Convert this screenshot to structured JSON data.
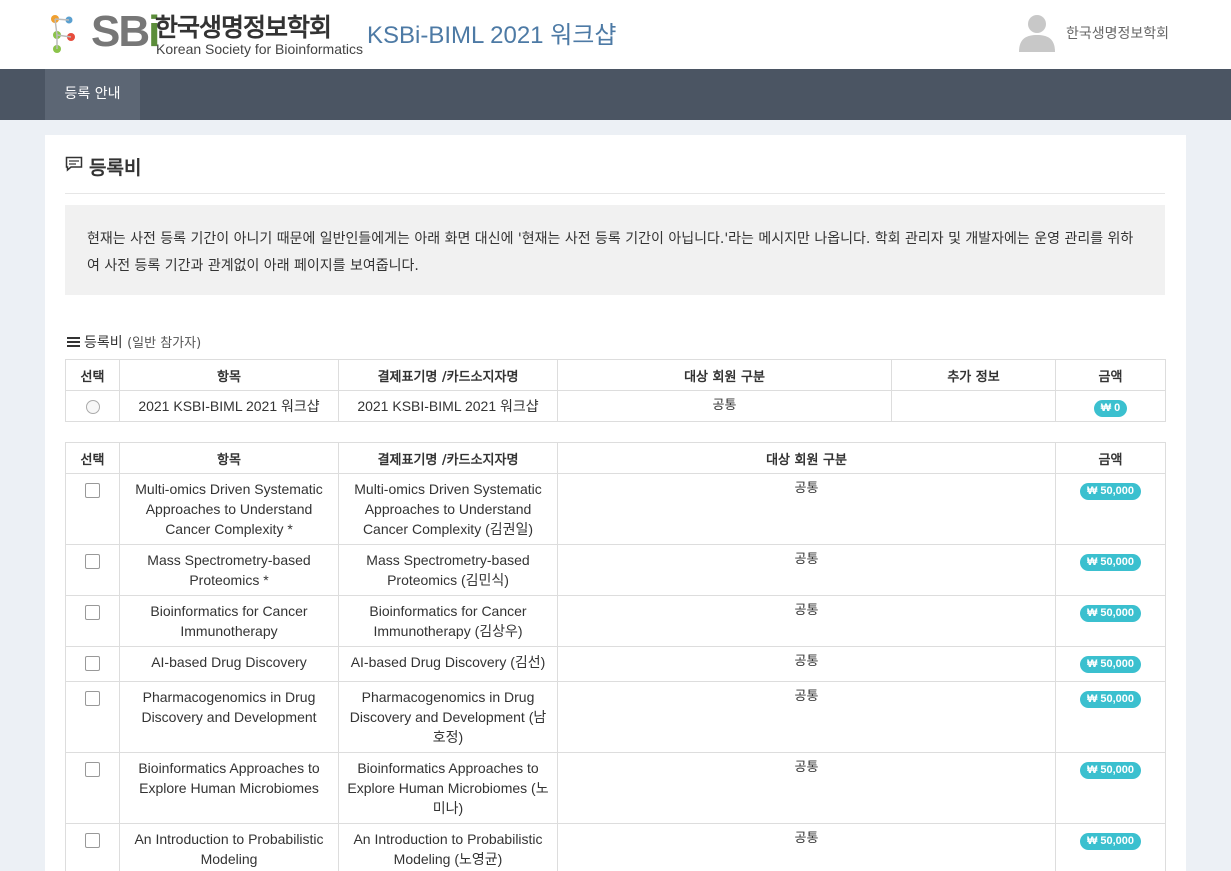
{
  "header": {
    "logo_sbi": "SB",
    "logo_i": "i",
    "logo_kr": "한국생명정보학회",
    "logo_en": "Korean Society for Bioinformatics",
    "site_title": "KSBi-BIML 2021 워크샵",
    "user_name": "한국생명정보학회"
  },
  "nav": {
    "tabs": [
      {
        "label": "등록 안내"
      }
    ]
  },
  "panel": {
    "title": "등록비",
    "notice": "현재는 사전 등록 기간이 아니기 때문에 일반인들에게는 아래 화면 대신에 '현재는 사전 등록 기간이 아닙니다.'라는 메시지만 나옵니다. 학회 관리자 및 개발자에는 운영 관리를 위하여 사전 등록 기간과 관계없이 아래 페이지를 보여줍니다.",
    "section_label": "등록비",
    "section_sub": "(일반 참가자)"
  },
  "table1": {
    "headers": [
      "선택",
      "항목",
      "결제표기명 /카드소지자명",
      "대상 회원 구분",
      "추가 정보",
      "금액"
    ],
    "rows": [
      {
        "item": "2021 KSBI-BIML 2021 워크샵",
        "billing": "2021 KSBI-BIML 2021 워크샵",
        "member": "공통",
        "extra": "",
        "price": "₩ 0"
      }
    ]
  },
  "table2": {
    "headers": [
      "선택",
      "항목",
      "결제표기명 /카드소지자명",
      "대상 회원 구분",
      "금액"
    ],
    "rows": [
      {
        "item": "Multi-omics Driven Systematic Approaches to Understand Cancer Complexity *",
        "billing": "Multi-omics Driven Systematic Approaches to Understand Cancer Complexity (김권일)",
        "member": "공통",
        "price": "₩ 50,000"
      },
      {
        "item": "Mass Spectrometry-based Proteomics *",
        "billing": "Mass Spectrometry-based Proteomics (김민식)",
        "member": "공통",
        "price": "₩ 50,000"
      },
      {
        "item": "Bioinformatics for Cancer Immunotherapy",
        "billing": "Bioinformatics for Cancer Immunotherapy (김상우)",
        "member": "공통",
        "price": "₩ 50,000"
      },
      {
        "item": "AI-based Drug Discovery",
        "billing": "AI-based Drug Discovery (김선)",
        "member": "공통",
        "price": "₩ 50,000"
      },
      {
        "item": "Pharmacogenomics in Drug Discovery and Development",
        "billing": "Pharmacogenomics in Drug Discovery and Development (남호정)",
        "member": "공통",
        "price": "₩ 50,000"
      },
      {
        "item": "Bioinformatics Approaches to Explore Human Microbiomes",
        "billing": "Bioinformatics Approaches to Explore Human Microbiomes (노미나)",
        "member": "공통",
        "price": "₩ 50,000"
      },
      {
        "item": "An Introduction to Probabilistic Modeling",
        "billing": "An Introduction to Probabilistic Modeling (노영균)",
        "member": "공통",
        "price": "₩ 50,000"
      }
    ]
  },
  "colors": {
    "nav_bg": "#4b5563",
    "nav_active": "#5c6674",
    "badge": "#3bc0cf",
    "title": "#4d7aa5"
  }
}
